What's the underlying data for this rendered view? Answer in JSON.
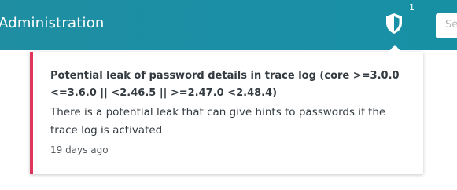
{
  "header": {
    "title": "Administration",
    "notification_count": "1",
    "search_placeholder": "Se",
    "shield_icon": "shield-icon"
  },
  "notification": {
    "title": "Potential leak of password details in trace log (core >=3.0.0 <=3.6.0 || <2.46.5 || >=2.47.0 <2.48.4)",
    "body": "There is a potential leak that can give hints to passwords if the trace log is activated",
    "time": "19 days ago",
    "accent_color": "#e0355a"
  },
  "colors": {
    "header_bg": "#1a8fa6",
    "text": "#333a40"
  }
}
